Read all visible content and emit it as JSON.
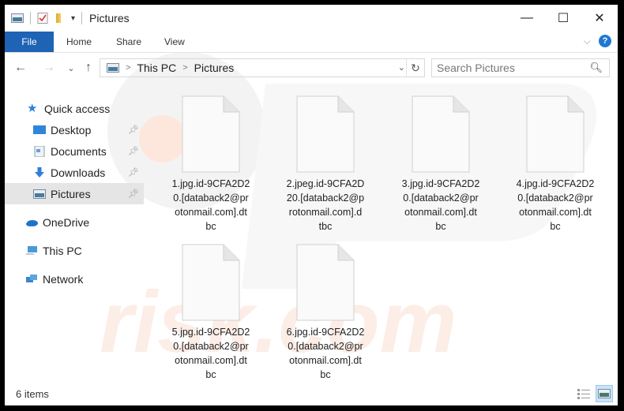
{
  "window": {
    "title": "Pictures",
    "controls": {
      "minimize": "—",
      "maximize": "☐",
      "close": "✕"
    }
  },
  "ribbon": {
    "tabs": [
      {
        "label": "File",
        "active": true
      },
      {
        "label": "Home"
      },
      {
        "label": "Share"
      },
      {
        "label": "View"
      }
    ],
    "expand_icon": "⌵",
    "help_label": "?"
  },
  "navigation": {
    "back": "←",
    "forward": "→",
    "recent": "⌄",
    "up": "↑",
    "breadcrumb": [
      "This PC",
      "Pictures"
    ],
    "crumb_separator": ">",
    "dropdown": "⌄",
    "refresh": "↻",
    "search_placeholder": "Search Pictures",
    "search_icon": "⚲"
  },
  "sidebar": {
    "quick_access": "Quick access",
    "items": [
      {
        "label": "Desktop",
        "icon": "desktop-icon",
        "pinned": true
      },
      {
        "label": "Documents",
        "icon": "documents-icon",
        "pinned": true
      },
      {
        "label": "Downloads",
        "icon": "downloads-icon",
        "pinned": true
      },
      {
        "label": "Pictures",
        "icon": "pictures-icon",
        "pinned": true,
        "selected": true
      }
    ],
    "locations": [
      {
        "label": "OneDrive",
        "icon": "onedrive-icon"
      },
      {
        "label": "This PC",
        "icon": "this-pc-icon"
      },
      {
        "label": "Network",
        "icon": "network-icon"
      }
    ],
    "pin_glyph": "📌"
  },
  "files": [
    {
      "name": "1.jpg.id-9CFA2D20.[databack2@protonmail.com].dtbc",
      "lines": [
        "1.jpg.id-9CFA2D2",
        "0.[databack2@pr",
        "otonmail.com].dt",
        "bc"
      ]
    },
    {
      "name": "2.jpeg.id-9CFA2D20.[databack2@protonmail.com].dtbc",
      "lines": [
        "2.jpeg.id-9CFA2D",
        "20.[databack2@p",
        "rotonmail.com].d",
        "tbc"
      ]
    },
    {
      "name": "3.jpg.id-9CFA2D20.[databack2@protonmail.com].dtbc",
      "lines": [
        "3.jpg.id-9CFA2D2",
        "0.[databack2@pr",
        "otonmail.com].dt",
        "bc"
      ]
    },
    {
      "name": "4.jpg.id-9CFA2D20.[databack2@protonmail.com].dtbc",
      "lines": [
        "4.jpg.id-9CFA2D2",
        "0.[databack2@pr",
        "otonmail.com].dt",
        "bc"
      ]
    },
    {
      "name": "5.jpg.id-9CFA2D20.[databack2@protonmail.com].dtbc",
      "lines": [
        "5.jpg.id-9CFA2D2",
        "0.[databack2@pr",
        "otonmail.com].dt",
        "bc"
      ]
    },
    {
      "name": "6.jpg.id-9CFA2D20.[databack2@protonmail.com].dtbc",
      "lines": [
        "6.jpg.id-9CFA2D2",
        "0.[databack2@pr",
        "otonmail.com].dt",
        "bc"
      ]
    }
  ],
  "status": {
    "item_count": "6 items",
    "view": "large-icons"
  },
  "colors": {
    "accent": "#1f63b5",
    "selected_bg": "#e5e5e5",
    "help": "#1f78d1",
    "watermark": "#f6d9c9"
  }
}
